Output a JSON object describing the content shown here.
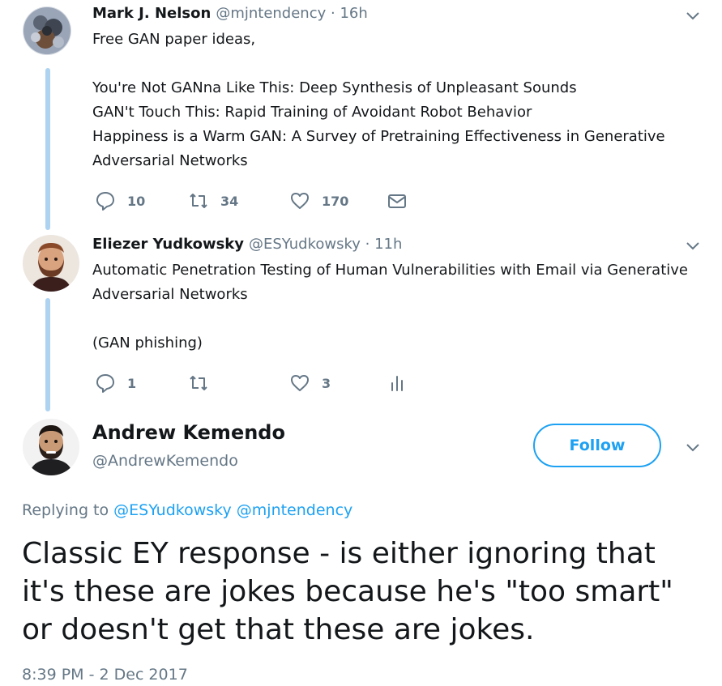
{
  "tweets": [
    {
      "name": "Mark J. Nelson",
      "handle": "@mjntendency",
      "separator": "·",
      "time": "16h",
      "lines": [
        "Free GAN paper ideas,",
        "",
        "You're Not GANna Like This: Deep Synthesis of Unpleasant Sounds",
        "GAN't Touch This: Rapid Training of Avoidant Robot Behavior",
        "Happiness is a Warm GAN: A Survey of Pretraining Effectiveness in Generative",
        "Adversarial Networks"
      ],
      "replies": "10",
      "retweets": "34",
      "likes": "170",
      "icons": {
        "reply": "reply-icon",
        "retweet": "retweet-icon",
        "like": "heart-icon",
        "dm": "envelope-icon",
        "menu": "chevron-down-icon"
      }
    },
    {
      "name": "Eliezer Yudkowsky",
      "handle": "@ESYudkowsky",
      "separator": "·",
      "time": "11h",
      "lines": [
        "Automatic Penetration Testing of Human Vulnerabilities with Email via Generative",
        "Adversarial Networks",
        "",
        "(GAN phishing)"
      ],
      "replies": "1",
      "retweets": "",
      "likes": "3",
      "icons": {
        "reply": "reply-icon",
        "retweet": "retweet-icon",
        "like": "heart-icon",
        "analytics": "analytics-icon",
        "menu": "chevron-down-icon"
      }
    }
  ],
  "main": {
    "name": "Andrew Kemendo",
    "handle": "@AndrewKemendo",
    "follow_label": "Follow",
    "replying_prefix": "Replying to",
    "mentions": [
      "@ESYudkowsky",
      "@mjntendency"
    ],
    "text_lines": [
      "Classic EY response - is either ignoring that",
      "it's these are jokes because he's \"too smart\"",
      "or doesn't get that these are jokes."
    ],
    "timestamp": "8:39 PM - 2 Dec 2017"
  },
  "colors": {
    "accent": "#1da1f2",
    "thread_line": "#aed3f1",
    "secondary_text": "#657786",
    "primary_text": "#14171a"
  }
}
